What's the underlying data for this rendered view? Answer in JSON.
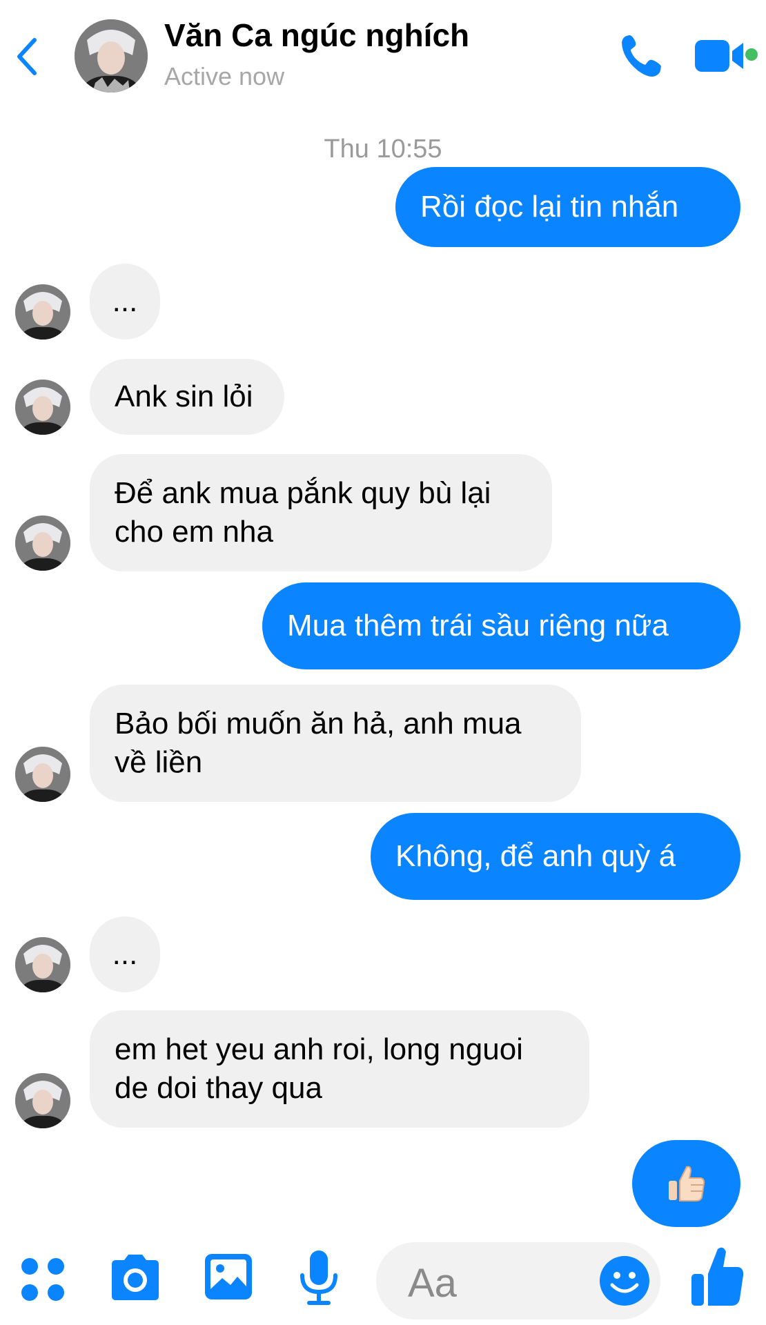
{
  "header": {
    "contact_name": "Văn Ca ngúc nghích",
    "status": "Active now"
  },
  "thread": {
    "timestamp": "Thu 10:55",
    "messages": [
      {
        "from": "me",
        "text": "Rồi đọc lại tin nhắn"
      },
      {
        "from": "them",
        "text": "..."
      },
      {
        "from": "them",
        "text": "Ank sin lỏi"
      },
      {
        "from": "them",
        "lines": [
          "Để ank mua pắnk quy bù lại",
          "cho em nha"
        ]
      },
      {
        "from": "me",
        "text": "Mua thêm trái sầu riêng nữa"
      },
      {
        "from": "them",
        "lines": [
          "Bảo bối muốn ăn hả, anh mua",
          "về liền"
        ]
      },
      {
        "from": "me",
        "text": "Không, để anh quỳ á"
      },
      {
        "from": "them",
        "text": "..."
      },
      {
        "from": "them",
        "lines": [
          "em het yeu anh roi, long nguoi",
          "de doi thay qua"
        ]
      },
      {
        "from": "me",
        "sticker": "thumbs-up"
      }
    ]
  },
  "composer": {
    "placeholder": "Aa"
  },
  "colors": {
    "accent": "#0a84ff",
    "incoming_bubble": "#f0f0f0",
    "online": "#45bd62"
  }
}
